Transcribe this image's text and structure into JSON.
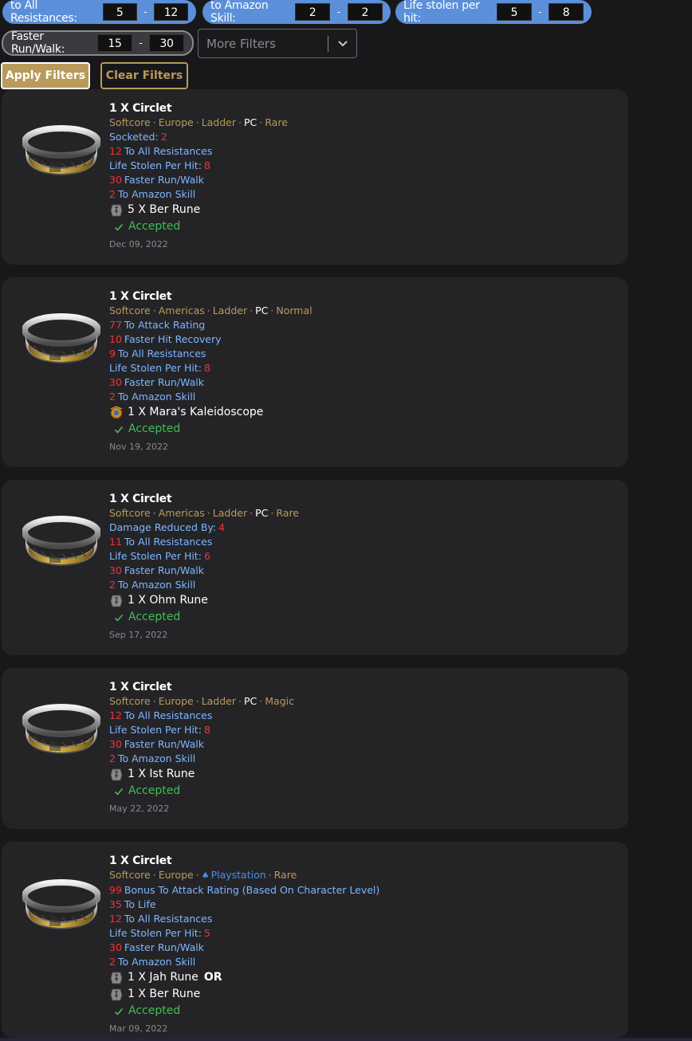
{
  "filters": {
    "all_res": {
      "label": "to All Resistances:",
      "min": "5",
      "max": "12"
    },
    "amazon": {
      "label": "to Amazon Skill:",
      "min": "2",
      "max": "2"
    },
    "life_stolen": {
      "label": "Life stolen per hit:",
      "min": "5",
      "max": "8"
    },
    "frw": {
      "label": "Faster Run/Walk:",
      "min": "15",
      "max": "30"
    },
    "dash": "-",
    "more_placeholder": "More Filters",
    "apply_label": "Apply Filters",
    "clear_label": "Clear Filters"
  },
  "colors": {
    "accent": "#b89a5a",
    "pill": "#5b8fd9",
    "stat": "#7fb6ff",
    "value": "#e8353b",
    "accepted": "#3fbf55"
  },
  "sep": "·",
  "listings": [
    {
      "title": "1 X Circlet",
      "meta": [
        "Softcore",
        "Europe",
        "Ladder",
        "PC",
        "Rare"
      ],
      "stats": [
        {
          "label": "Socketed:",
          "value": "2",
          "pos": "post"
        },
        {
          "label": "To All Resistances",
          "value": "12",
          "pos": "pre"
        },
        {
          "label": "Life Stolen Per Hit:",
          "value": "8",
          "pos": "post"
        },
        {
          "label": "Faster Run/Walk",
          "value": "30",
          "pos": "pre"
        },
        {
          "label": "To Amazon Skill",
          "value": "2",
          "pos": "pre"
        }
      ],
      "offers": [
        {
          "text": "5 X Ber Rune",
          "icon": "ber-rune-icon",
          "or": ""
        }
      ],
      "status": "Accepted",
      "date": "Dec 09, 2022"
    },
    {
      "title": "1 X Circlet",
      "meta": [
        "Softcore",
        "Americas",
        "Ladder",
        "PC",
        "Normal"
      ],
      "stats": [
        {
          "label": "To Attack Rating",
          "value": "77",
          "pos": "pre"
        },
        {
          "label": "Faster Hit Recovery",
          "value": "10",
          "pos": "pre"
        },
        {
          "label": "To All Resistances",
          "value": "9",
          "pos": "pre"
        },
        {
          "label": "Life Stolen Per Hit:",
          "value": "8",
          "pos": "post"
        },
        {
          "label": "Faster Run/Walk",
          "value": "30",
          "pos": "pre"
        },
        {
          "label": "To Amazon Skill",
          "value": "2",
          "pos": "pre"
        }
      ],
      "offers": [
        {
          "text": "1 X Mara's Kaleidoscope",
          "icon": "amulet-icon",
          "or": ""
        }
      ],
      "status": "Accepted",
      "date": "Nov 19, 2022"
    },
    {
      "title": "1 X Circlet",
      "meta": [
        "Softcore",
        "Americas",
        "Ladder",
        "PC",
        "Rare"
      ],
      "stats": [
        {
          "label": "Damage Reduced By:",
          "value": "4",
          "pos": "post"
        },
        {
          "label": "To All Resistances",
          "value": "11",
          "pos": "pre"
        },
        {
          "label": "Life Stolen Per Hit:",
          "value": "6",
          "pos": "post"
        },
        {
          "label": "Faster Run/Walk",
          "value": "30",
          "pos": "pre"
        },
        {
          "label": "To Amazon Skill",
          "value": "2",
          "pos": "pre"
        }
      ],
      "offers": [
        {
          "text": "1 X Ohm Rune",
          "icon": "ohm-rune-icon",
          "or": ""
        }
      ],
      "status": "Accepted",
      "date": "Sep 17, 2022"
    },
    {
      "title": "1 X Circlet",
      "meta": [
        "Softcore",
        "Europe",
        "Ladder",
        "PC",
        "Magic"
      ],
      "stats": [
        {
          "label": "To All Resistances",
          "value": "12",
          "pos": "pre"
        },
        {
          "label": "Life Stolen Per Hit:",
          "value": "8",
          "pos": "post"
        },
        {
          "label": "Faster Run/Walk",
          "value": "30",
          "pos": "pre"
        },
        {
          "label": "To Amazon Skill",
          "value": "2",
          "pos": "pre"
        }
      ],
      "offers": [
        {
          "text": "1 X Ist Rune",
          "icon": "ist-rune-icon",
          "or": ""
        }
      ],
      "status": "Accepted",
      "date": "May 22, 2022"
    },
    {
      "title": "1 X Circlet",
      "meta": [
        "Softcore",
        "Europe",
        "Playstation",
        "Rare"
      ],
      "stats": [
        {
          "label": "Bonus To Attack Rating (Based On Character Level)",
          "value": "99",
          "pos": "pre"
        },
        {
          "label": "To Life",
          "value": "35",
          "pos": "pre"
        },
        {
          "label": "To All Resistances",
          "value": "12",
          "pos": "pre"
        },
        {
          "label": "Life Stolen Per Hit:",
          "value": "5",
          "pos": "post"
        },
        {
          "label": "Faster Run/Walk",
          "value": "30",
          "pos": "pre"
        },
        {
          "label": "To Amazon Skill",
          "value": "2",
          "pos": "pre"
        }
      ],
      "offers": [
        {
          "text": "1 X Jah Rune",
          "icon": "jah-rune-icon",
          "or": "OR"
        },
        {
          "text": "1 X Ber Rune",
          "icon": "ber-rune-icon",
          "or": ""
        }
      ],
      "status": "Accepted",
      "date": "Mar 09, 2022"
    }
  ]
}
